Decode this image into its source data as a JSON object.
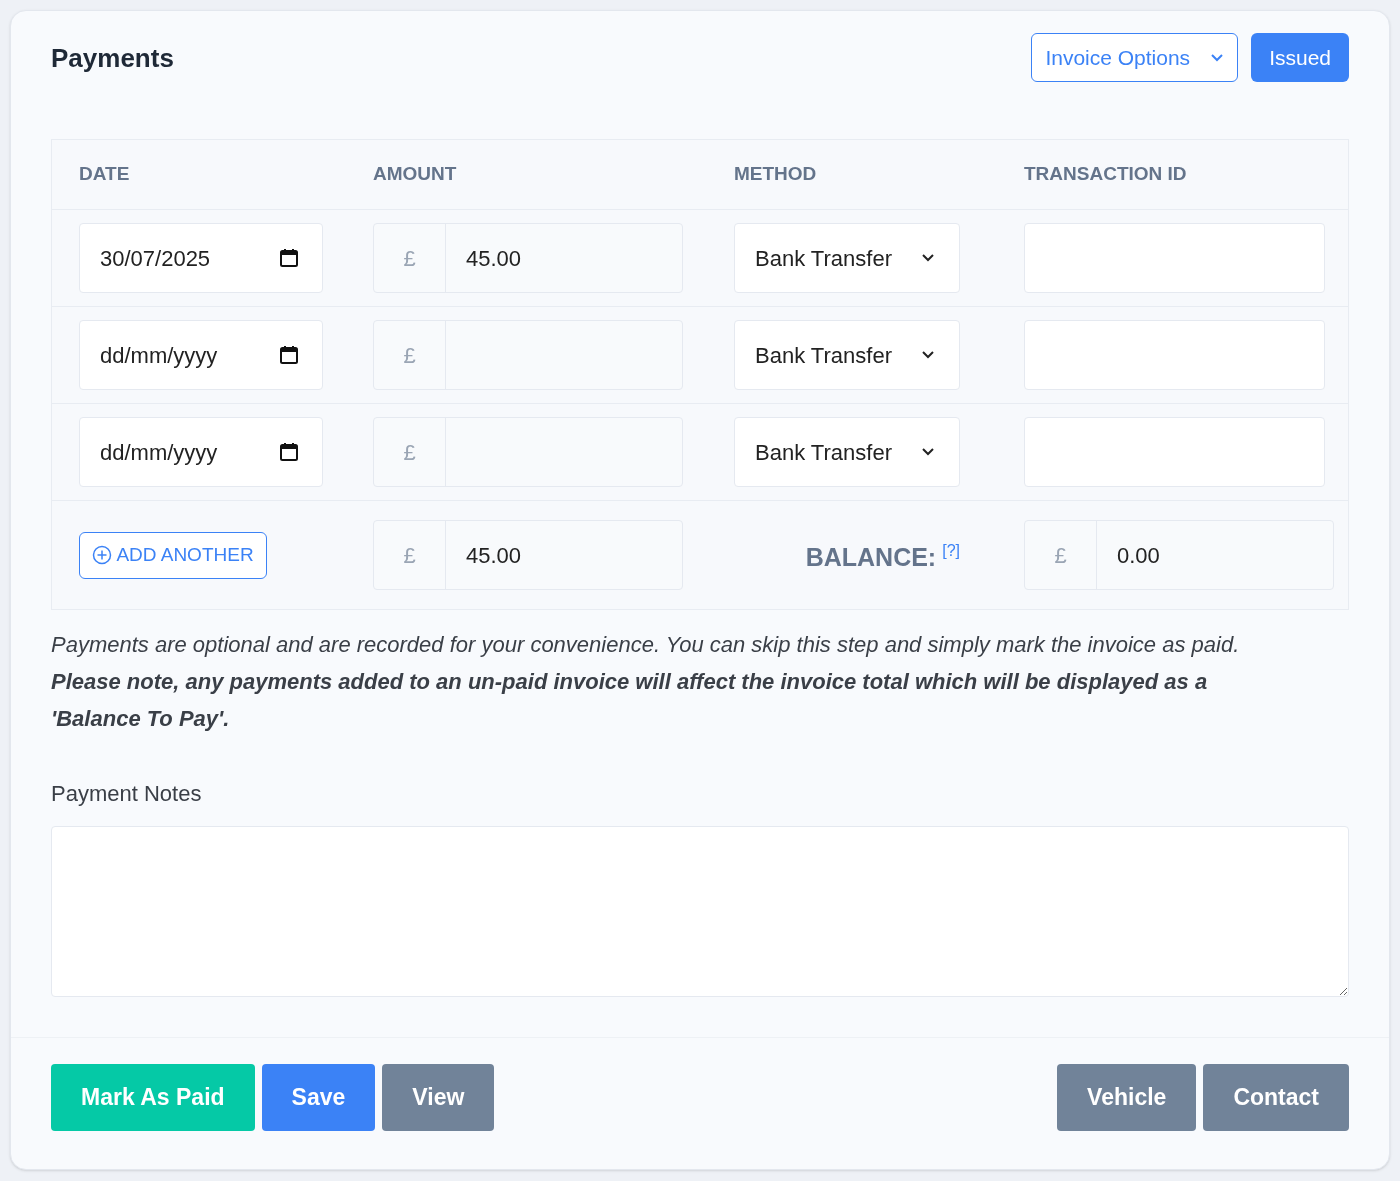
{
  "title": "Payments",
  "header_buttons": [
    {
      "label": "Invoice Options",
      "kind": "dropdown"
    },
    {
      "label": "Issued",
      "kind": "primary"
    }
  ],
  "table": {
    "columns": [
      "DATE",
      "AMOUNT",
      "METHOD",
      "TRANSACTION ID"
    ],
    "rows": [
      {
        "date": {
          "value": "30/07/2025"
        },
        "currency": "£",
        "amount": "45.00",
        "method": "Bank Transfer"
      },
      {
        "date": {
          "placeholder": "dd/mm/yyyy"
        },
        "currency": "£",
        "method": "Bank Transfer"
      },
      {
        "date": {
          "placeholder": "dd/mm/yyyy"
        },
        "currency": "£",
        "method": "Bank Transfer"
      }
    ],
    "footer": {
      "add_button": "ADD ANOTHER",
      "total_currency": "£",
      "total": "45.00",
      "balance_label": "BALANCE:",
      "balance_help": "[?]",
      "balance_currency": "£",
      "balance": "0.00"
    }
  },
  "note": [
    {
      "kind": "info",
      "text": "Payments are optional and are recorded for your convenience. You can skip this step and simply mark the invoice as paid."
    },
    {
      "kind": "warning",
      "text": "Please note, any payments added to an un-paid invoice will affect the invoice total which will be displayed as a 'Balance To Pay'."
    }
  ],
  "payment_notes": {
    "label": "Payment Notes"
  },
  "actions_left": [
    {
      "label": "Mark As Paid",
      "kind": "success"
    },
    {
      "label": "Save",
      "kind": "primary"
    },
    {
      "label": "View",
      "kind": "secondary"
    }
  ],
  "actions_right": [
    {
      "label": "Vehicle",
      "kind": "secondary"
    },
    {
      "label": "Contact",
      "kind": "secondary"
    }
  ]
}
